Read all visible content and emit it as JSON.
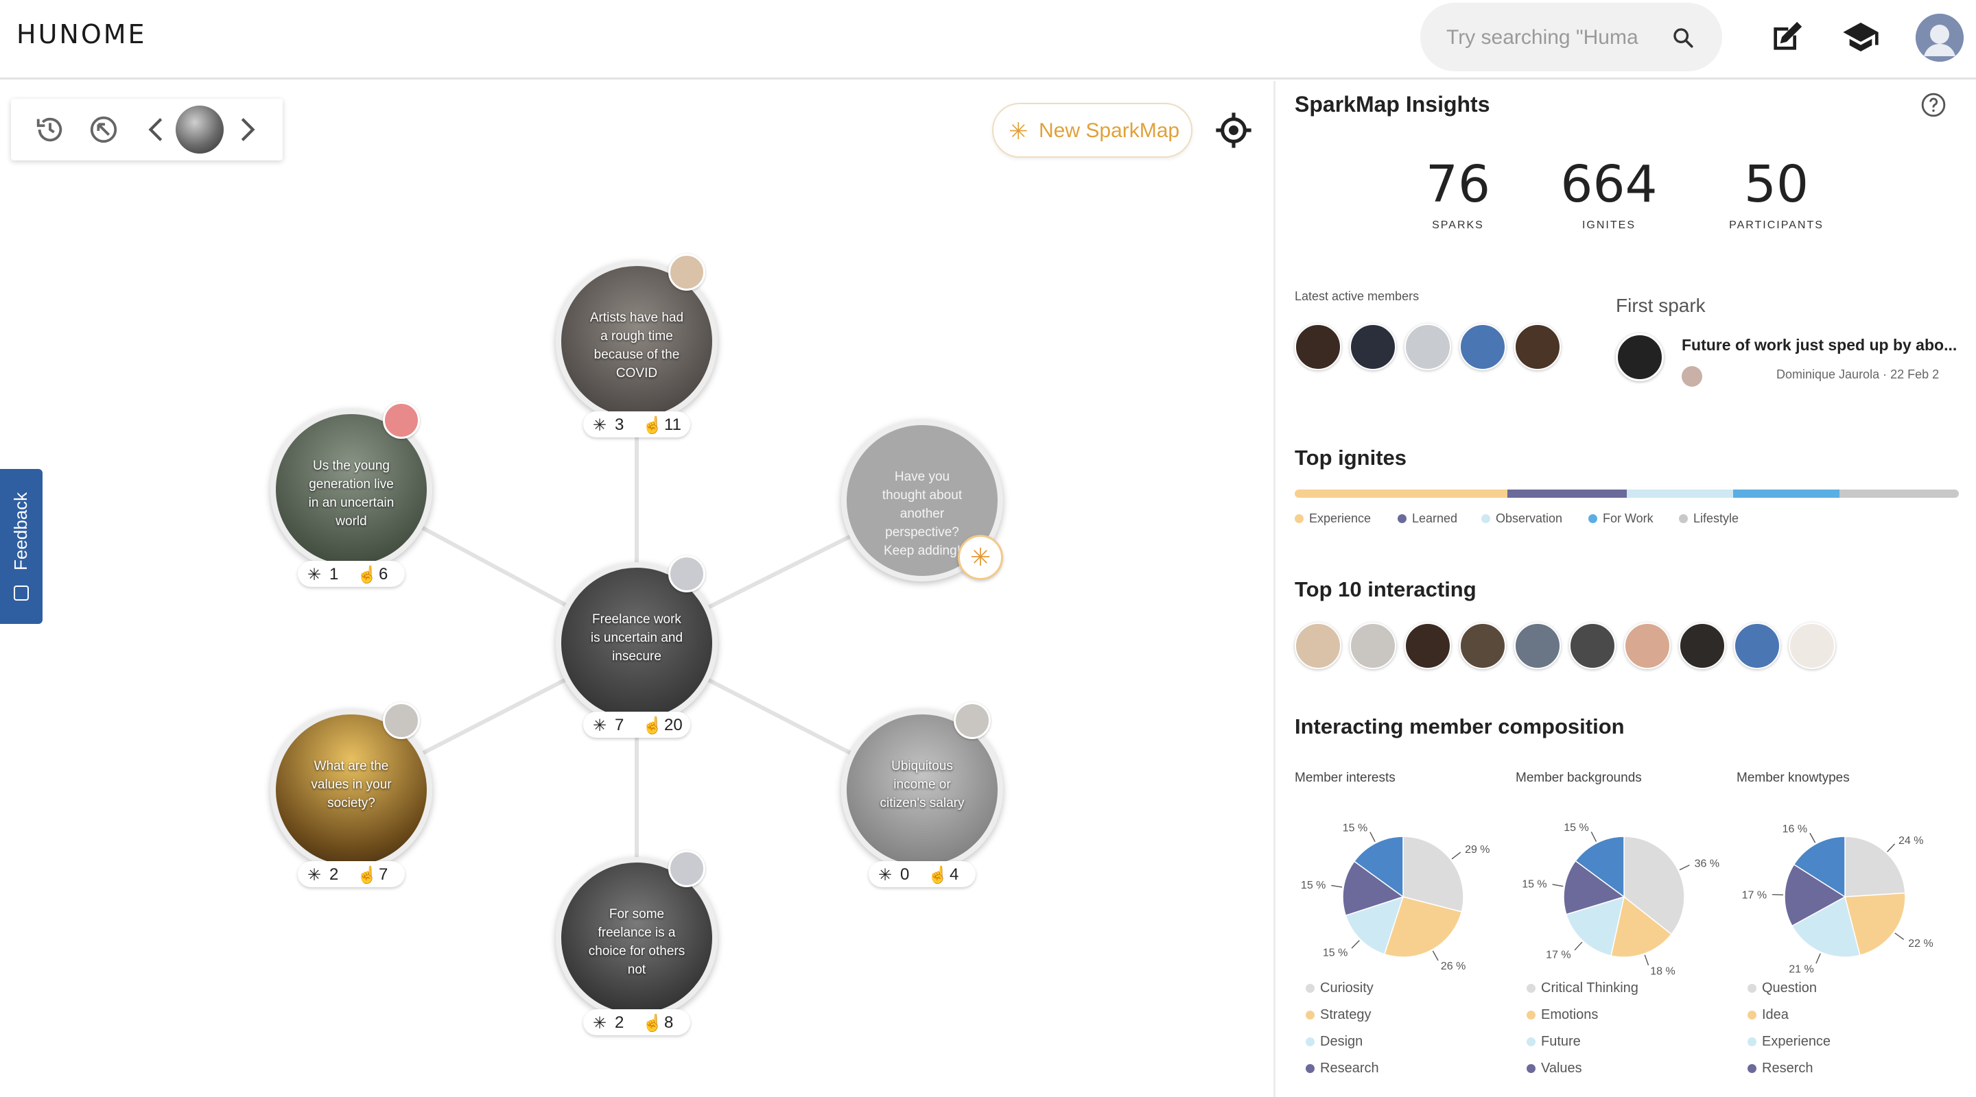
{
  "header": {
    "logo": "HUNOME",
    "search_placeholder": "Try searching \"Huma",
    "icons": [
      "search-icon",
      "edit-icon",
      "graduation-cap-icon",
      "user-avatar"
    ]
  },
  "toolbar": {
    "icons": [
      "history-icon",
      "recenter-icon",
      "chevron-left-icon",
      "globe-avatar",
      "chevron-right-icon"
    ],
    "new_sparkmap_label": "New SparkMap"
  },
  "feedback_label": "Feedback",
  "nodes": [
    {
      "id": "center",
      "text": "Freelance work is uncertain and insecure",
      "sparks": "7",
      "ignites": "20",
      "bg": "#3c3c3c"
    },
    {
      "id": "top",
      "text": "Artists have had a rough time because of the COVID",
      "sparks": "3",
      "ignites": "11",
      "bg": "#6e6a66"
    },
    {
      "id": "upper-left",
      "text": "Us the young generation live in an uncertain world",
      "sparks": "1",
      "ignites": "6",
      "bg": "#5a5e54"
    },
    {
      "id": "lower-left",
      "text": "What are the values in your society?",
      "sparks": "2",
      "ignites": "7",
      "bg": "#b38a3e"
    },
    {
      "id": "bottom",
      "text": "For some freelance is a choice for others not",
      "sparks": "2",
      "ignites": "8",
      "bg": "#444444"
    },
    {
      "id": "lower-right",
      "text": "Ubiquitous income or citizen's salary",
      "sparks": "0",
      "ignites": "4",
      "bg": "#8a8a8a"
    },
    {
      "id": "upper-right",
      "text": "Have you thought about another perspective? Keep adding!",
      "sparks": "",
      "ignites": "",
      "bg": "#a8a8a8"
    }
  ],
  "panel": {
    "title": "SparkMap Insights",
    "metrics": [
      {
        "value": "76",
        "label": "SPARKS"
      },
      {
        "value": "664",
        "label": "IGNITES"
      },
      {
        "value": "50",
        "label": "PARTICIPANTS"
      }
    ],
    "latest_members_label": "Latest active members",
    "latest_member_colors": [
      "#3b2a22",
      "#2b2f3c",
      "#c8ccd0",
      "#4a76b3",
      "#4a3526"
    ],
    "first_spark": {
      "title": "First spark",
      "text": "Future of work just sped up by abo...",
      "author": "Dominique Jaurola",
      "date": "22 Feb 2",
      "separator": "·"
    },
    "top_ignites": {
      "title": "Top ignites",
      "segments": [
        {
          "name": "Experience",
          "value": 32,
          "color": "#f7d08f"
        },
        {
          "name": "Learned",
          "value": 18,
          "color": "#6b6a9a"
        },
        {
          "name": "Observation",
          "value": 16,
          "color": "#cfe8f3"
        },
        {
          "name": "For Work",
          "value": 16,
          "color": "#5aaee3"
        },
        {
          "name": "Lifestyle",
          "value": 18,
          "color": "#c8c8c8"
        }
      ]
    },
    "top_interacting": {
      "title": "Top 10 interacting",
      "colors": [
        "#d9c2a8",
        "#c9c5c0",
        "#3b2a22",
        "#5a4a3c",
        "#6a7586",
        "#4a4a4a",
        "#d8a890",
        "#2e2a28",
        "#4a76b3",
        "#efe9e4"
      ]
    },
    "composition": {
      "title": "Interacting member composition",
      "charts": [
        {
          "title": "Member interests",
          "slices": [
            29,
            26,
            15,
            15,
            15
          ],
          "labels": [
            "29 %",
            "26 %",
            "15 %",
            "15 %",
            "15 %"
          ],
          "legend": [
            "Curiosity",
            "Strategy",
            "Design",
            "Research"
          ]
        },
        {
          "title": "Member backgrounds",
          "slices": [
            36,
            18,
            17,
            15,
            15
          ],
          "labels": [
            "36 %",
            "18 %",
            "17 %",
            "15 %",
            "15 %"
          ],
          "legend": [
            "Critical Thinking",
            "Emotions",
            "Future",
            "Values"
          ]
        },
        {
          "title": "Member knowtypes",
          "slices": [
            24,
            22,
            21,
            17,
            16
          ],
          "labels": [
            "24 %",
            "22 %",
            "21 %",
            "17 %",
            "16 %"
          ],
          "legend": [
            "Question",
            "Idea",
            "Experience",
            "Reserch"
          ]
        }
      ],
      "slice_colors": [
        "#dcdcdc",
        "#f7d08f",
        "#cde9f4",
        "#6b6a9a",
        "#4a86c8"
      ]
    }
  }
}
